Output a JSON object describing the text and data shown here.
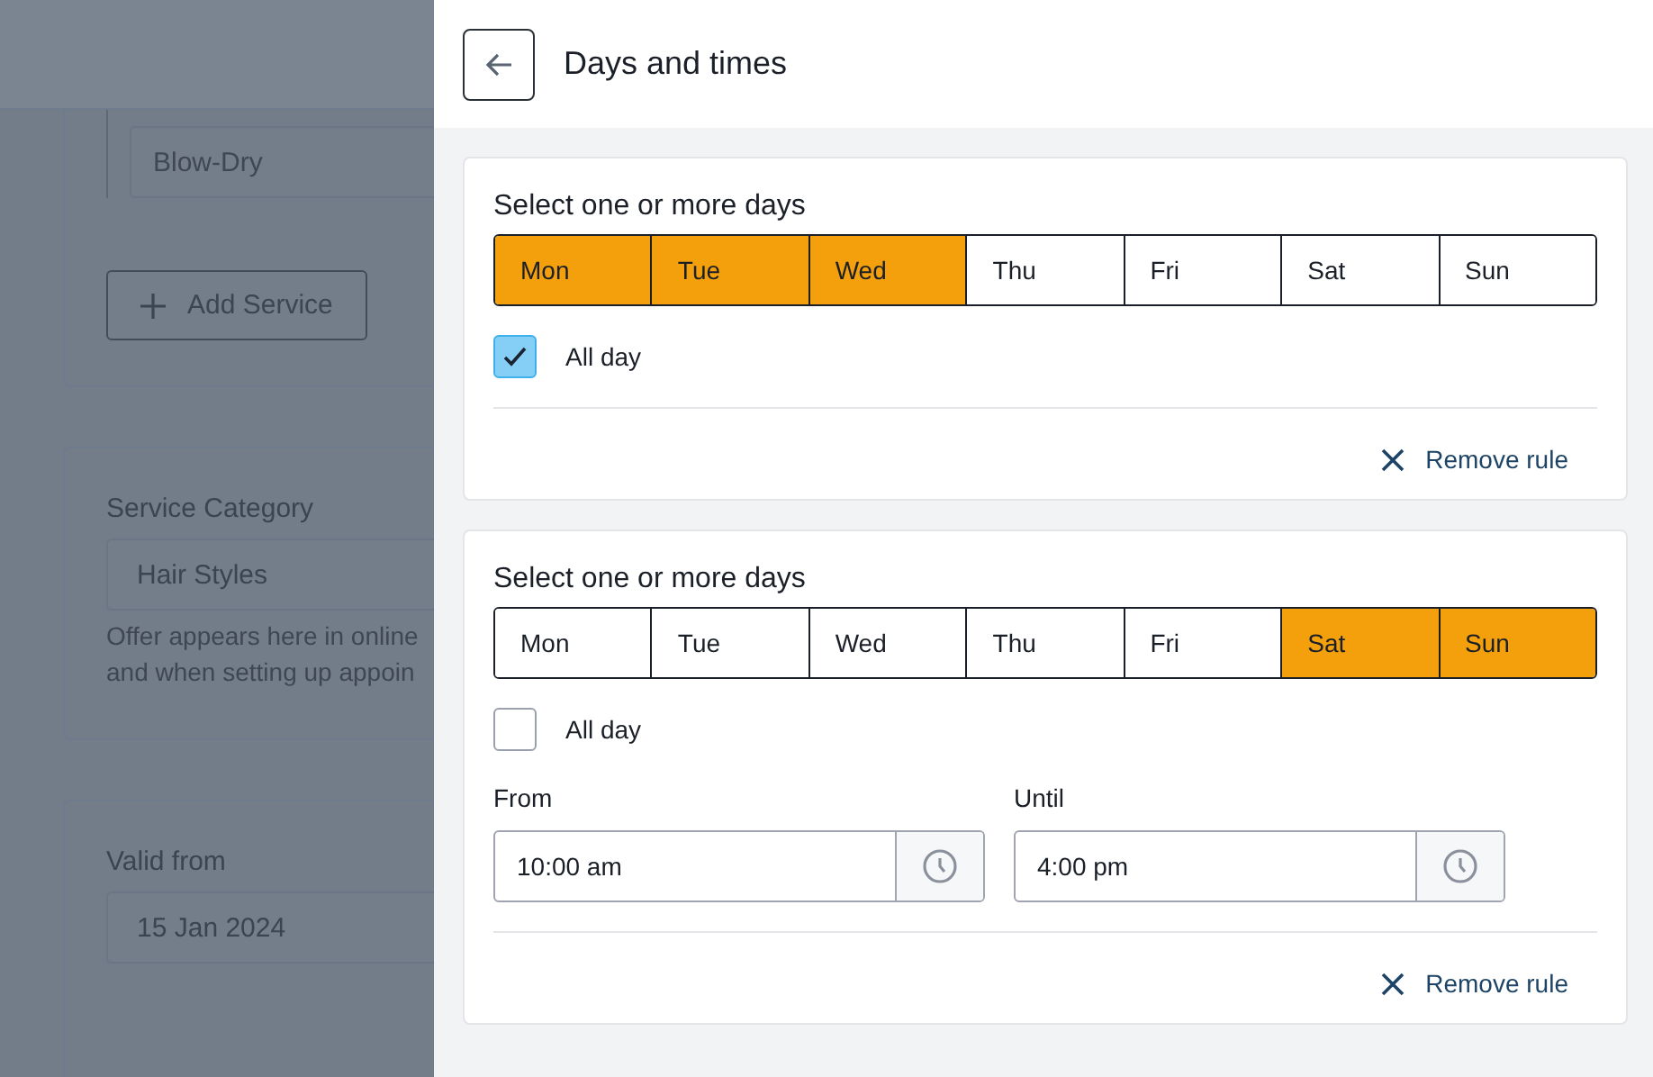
{
  "background": {
    "service_input": {
      "placeholder": "Blow-Dry"
    },
    "add_service_button": "Add Service",
    "service_category": {
      "label": "Service Category",
      "value": "Hair Styles",
      "helper_lines": [
        "Offer appears here in online",
        "and when setting up appoin"
      ]
    },
    "valid_from": {
      "label": "Valid from",
      "value": "15 Jan 2024"
    }
  },
  "panel": {
    "title": "Days and times",
    "rules": [
      {
        "heading": "Select one or more days",
        "days": [
          {
            "label": "Mon",
            "selected": true
          },
          {
            "label": "Tue",
            "selected": true
          },
          {
            "label": "Wed",
            "selected": true
          },
          {
            "label": "Thu",
            "selected": false
          },
          {
            "label": "Fri",
            "selected": false
          },
          {
            "label": "Sat",
            "selected": false
          },
          {
            "label": "Sun",
            "selected": false
          }
        ],
        "all_day": {
          "label": "All day",
          "checked": true
        },
        "remove_label": "Remove rule"
      },
      {
        "heading": "Select one or more days",
        "days": [
          {
            "label": "Mon",
            "selected": false
          },
          {
            "label": "Tue",
            "selected": false
          },
          {
            "label": "Wed",
            "selected": false
          },
          {
            "label": "Thu",
            "selected": false
          },
          {
            "label": "Fri",
            "selected": false
          },
          {
            "label": "Sat",
            "selected": true
          },
          {
            "label": "Sun",
            "selected": true
          }
        ],
        "all_day": {
          "label": "All day",
          "checked": false
        },
        "from": {
          "label": "From",
          "value": "10:00 am"
        },
        "until": {
          "label": "Until",
          "value": "4:00 pm"
        },
        "remove_label": "Remove rule"
      }
    ]
  }
}
